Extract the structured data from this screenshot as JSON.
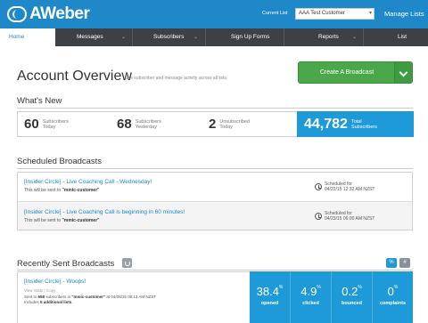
{
  "header": {
    "brand": "AWeber",
    "current_list_label": "Current List",
    "current_list_value": "AAA Test Customer",
    "manage_lists": "Manage Lists"
  },
  "nav": [
    {
      "label": "Home",
      "active": true
    },
    {
      "label": "Messages"
    },
    {
      "label": "Subscribers"
    },
    {
      "label": "Sign Up Forms"
    },
    {
      "label": "Reports"
    },
    {
      "label": "List Options"
    }
  ],
  "overview": {
    "title": "Account Overview",
    "subtitle": "See subscriber and message activity across all lists.",
    "create_button": "Create A Broadcast"
  },
  "whats_new": {
    "title": "What's New",
    "stats": [
      {
        "value": "60",
        "label_line1": "Subscribers",
        "label_line2": "Today"
      },
      {
        "value": "68",
        "label_line1": "Subscribers",
        "label_line2": "Yesterday"
      },
      {
        "value": "2",
        "label_line1": "Unsubscribed",
        "label_line2": "Today"
      }
    ],
    "total": {
      "value": "44,782",
      "label_line1": "Total",
      "label_line2": "Subscribers"
    }
  },
  "scheduled": {
    "title": "Scheduled Broadcasts",
    "items": [
      {
        "title": "[Insider Circle] - Live Coaching Call - Wednesday!",
        "sent_prefix": "This will be sent to",
        "list": "\"mmic-customer\"",
        "time_label": "Scheduled for",
        "time": "04/22/15 12:32 AM NZST"
      },
      {
        "title": "[Insider Circle] - Live Coaching Call is beginning in 60 minutes!",
        "sent_prefix": "This will be sent to",
        "list": "\"mmic-customer\"",
        "time_label": "Scheduled for",
        "time": "04/23/15 06:00 AM NZST"
      }
    ]
  },
  "recent": {
    "title": "Recently Sent Broadcasts",
    "pct_toggle": "%",
    "hash_toggle": "#",
    "item": {
      "title": "[Insider Circle] - Woops!",
      "view_links": "View Stats | Copy",
      "sent_line1_a": "Sent to",
      "sent_count": "658",
      "sent_line1_b": "subscribers in",
      "sent_list": "\"mmic-customer\"",
      "sent_line1_c": "at 04/08/15 08:13 AM NZST",
      "sent_line2_a": "Includes",
      "sent_additional": "5 additional lists",
      "sent_line2_b": "."
    },
    "metrics": [
      {
        "value": "38.4",
        "unit": "%",
        "label": "opened"
      },
      {
        "value": "4.9",
        "unit": "%",
        "label": "clicked"
      },
      {
        "value": "0.2",
        "unit": "%",
        "label": "bounced"
      },
      {
        "value": "0",
        "unit": "%",
        "label": "complaints"
      }
    ]
  }
}
